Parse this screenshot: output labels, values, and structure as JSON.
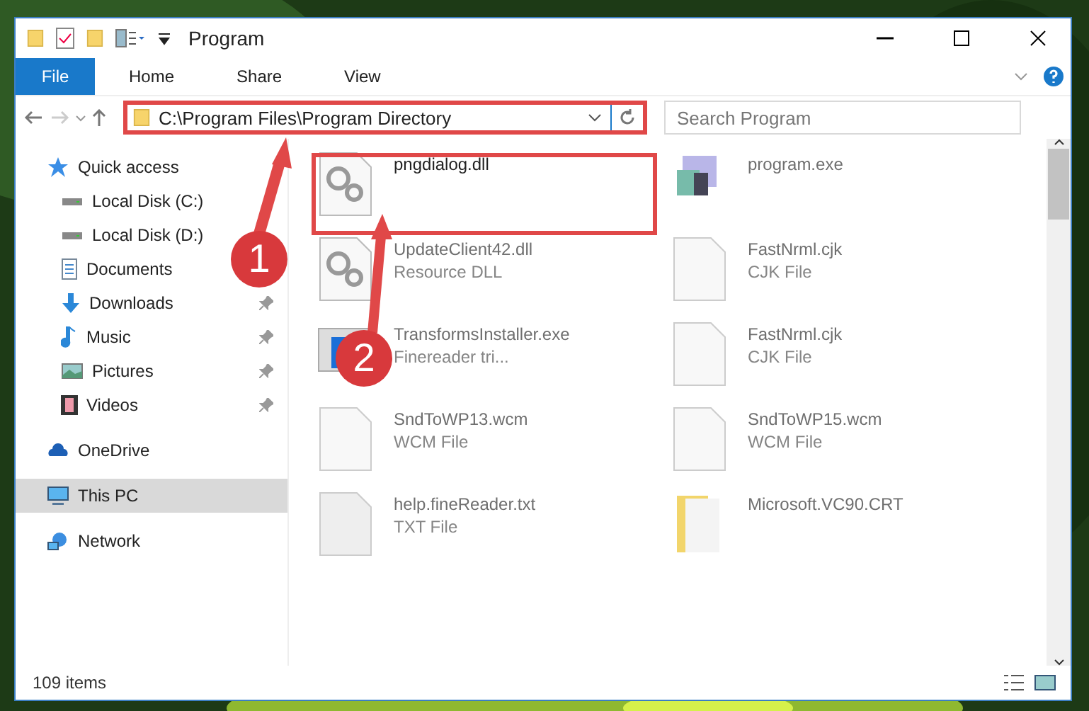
{
  "window": {
    "title": "Program"
  },
  "file_menu": "File",
  "ribbon_tabs": [
    "Home",
    "Share",
    "View"
  ],
  "address": {
    "path": "C:\\Program Files\\Program Directory",
    "highlighted": true
  },
  "search": {
    "placeholder": "Search Program"
  },
  "sidebar": {
    "items": [
      {
        "label": "Quick access",
        "kind": "star",
        "selected": false,
        "children": [
          {
            "label": "Local Disk (C:)",
            "kind": "drive",
            "pinned": false
          },
          {
            "label": "Local Disk (D:)",
            "kind": "drive",
            "pinned": false
          },
          {
            "label": "Documents",
            "kind": "document",
            "pinned": false
          },
          {
            "label": "Downloads",
            "kind": "download",
            "pinned": true
          },
          {
            "label": "Music",
            "kind": "music",
            "pinned": true
          },
          {
            "label": "Pictures",
            "kind": "pictures",
            "pinned": true
          },
          {
            "label": "Videos",
            "kind": "videos",
            "pinned": true
          }
        ]
      },
      {
        "label": "OneDrive",
        "kind": "cloud",
        "selected": false
      },
      {
        "label": "This PC",
        "kind": "pc",
        "selected": true
      },
      {
        "label": "Network",
        "kind": "network",
        "selected": false
      }
    ]
  },
  "files": [
    {
      "name": "pngdialog.dll",
      "kind": "gears",
      "highlighted": true
    },
    {
      "name": "program.exe",
      "kind": "installer",
      "highlighted": false
    },
    {
      "name": "UpdateClient42.dll",
      "type": "Resource DLL",
      "kind": "gears",
      "highlighted": false
    },
    {
      "name": "FastNrml.cjk",
      "type": "CJK File",
      "kind": "blank",
      "highlighted": false
    },
    {
      "name": "TransformsInstaller.exe",
      "type": "Finereader tri...",
      "kind": "window",
      "highlighted": false
    },
    {
      "name": "FastNrml.cjk",
      "type": "CJK File",
      "kind": "blank",
      "highlighted": false
    },
    {
      "name": "SndToWP13.wcm",
      "type": "WCM File",
      "kind": "blank",
      "highlighted": false
    },
    {
      "name": "SndToWP15.wcm",
      "type": "WCM File",
      "kind": "blank",
      "highlighted": false
    },
    {
      "name": "help.fineReader.txt",
      "type": "TXT File",
      "kind": "text",
      "highlighted": false
    },
    {
      "name": "Microsoft.VC90.CRT",
      "kind": "folder",
      "highlighted": false
    }
  ],
  "status_bar": {
    "count": "109 items"
  },
  "annotations": [
    {
      "number": "1"
    },
    {
      "number": "2"
    }
  ]
}
